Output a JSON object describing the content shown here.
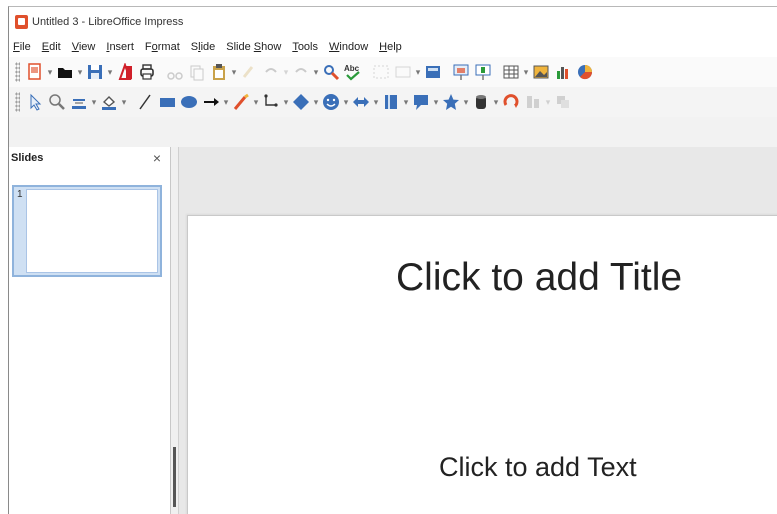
{
  "window": {
    "title": "Untitled 3 - LibreOffice Impress"
  },
  "menubar": {
    "items": [
      {
        "label": "File",
        "accel": "F",
        "rest": "ile"
      },
      {
        "label": "Edit",
        "accel": "E",
        "rest": "dit"
      },
      {
        "label": "View",
        "accel": "V",
        "rest": "iew"
      },
      {
        "label": "Insert",
        "accel": "I",
        "rest": "nsert"
      },
      {
        "label": "Format",
        "pre": "F",
        "accel": "o",
        "rest": "rmat"
      },
      {
        "label": "Slide",
        "pre": "S",
        "accel": "l",
        "rest": "ide"
      },
      {
        "label": "Slide Show",
        "pre": "Slide ",
        "accel": "S",
        "rest": "how"
      },
      {
        "label": "Tools",
        "accel": "T",
        "rest": "ools"
      },
      {
        "label": "Window",
        "accel": "W",
        "rest": "indow"
      },
      {
        "label": "Help",
        "accel": "H",
        "rest": "elp"
      }
    ]
  },
  "toolbar_standard": {
    "icons": [
      "new-icon",
      "open-icon",
      "save-icon",
      "export-pdf-icon",
      "print-icon",
      "cut-icon",
      "copy-icon",
      "paste-icon",
      "clone-formatting-icon",
      "undo-icon",
      "redo-icon",
      "find-replace-icon",
      "spelling-icon",
      "grid-icon",
      "display-views-icon",
      "master-slide-icon",
      "start-presentation-icon",
      "start-from-current-icon",
      "table-icon",
      "image-icon",
      "chart-icon",
      "pie-icon"
    ]
  },
  "toolbar_drawing": {
    "icons": [
      "select-icon",
      "zoom-icon",
      "line-color-icon",
      "fill-color-icon",
      "line-icon",
      "rectangle-icon",
      "ellipse-icon",
      "arrow-line-icon",
      "curve-icon",
      "connector-icon",
      "diamond-shape-icon",
      "smiley-icon",
      "double-arrow-icon",
      "flowchart-icon",
      "callout-icon",
      "star-icon",
      "3d-object-icon",
      "rotate-icon",
      "align-icon",
      "arrange-icon"
    ]
  },
  "slides_panel": {
    "title": "Slides",
    "close_label": "×",
    "slide_number": "1"
  },
  "slide": {
    "title_placeholder": "Click to add Title",
    "text_placeholder": "Click to add Text"
  },
  "colors": {
    "accent": "#e0502c",
    "selection": "#8fb3dc",
    "toolbar_blue": "#3a6fb8"
  }
}
